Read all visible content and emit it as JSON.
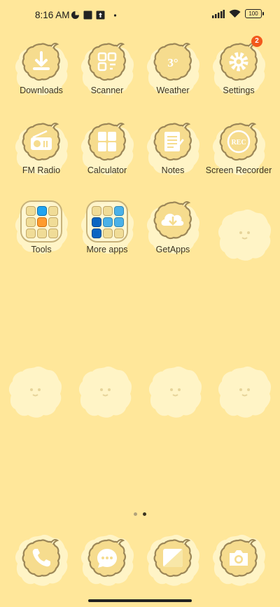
{
  "status_bar": {
    "time": "8:16 AM",
    "battery": "100"
  },
  "apps": [
    {
      "label": "Downloads"
    },
    {
      "label": "Scanner"
    },
    {
      "label": "Weather"
    },
    {
      "label": "Settings",
      "badge": "2"
    },
    {
      "label": "FM Radio"
    },
    {
      "label": "Calculator"
    },
    {
      "label": "Notes"
    },
    {
      "label": "Screen Recorder"
    },
    {
      "label": "Tools"
    },
    {
      "label": "More apps"
    },
    {
      "label": "GetApps"
    }
  ],
  "icon_glyphs": {
    "weather": "3°",
    "rec": "REC"
  },
  "page_indicator": {
    "count": 2,
    "active": 2
  },
  "dock": [
    {
      "name": "phone"
    },
    {
      "name": "messages"
    },
    {
      "name": "gallery"
    },
    {
      "name": "camera"
    }
  ],
  "colors": {
    "wallpaper": "#FFE79A",
    "blob": "#FFF4C6",
    "icon_fill": "#F6DC8E",
    "icon_stroke": "#9C8758",
    "badge": "#F2591C"
  }
}
